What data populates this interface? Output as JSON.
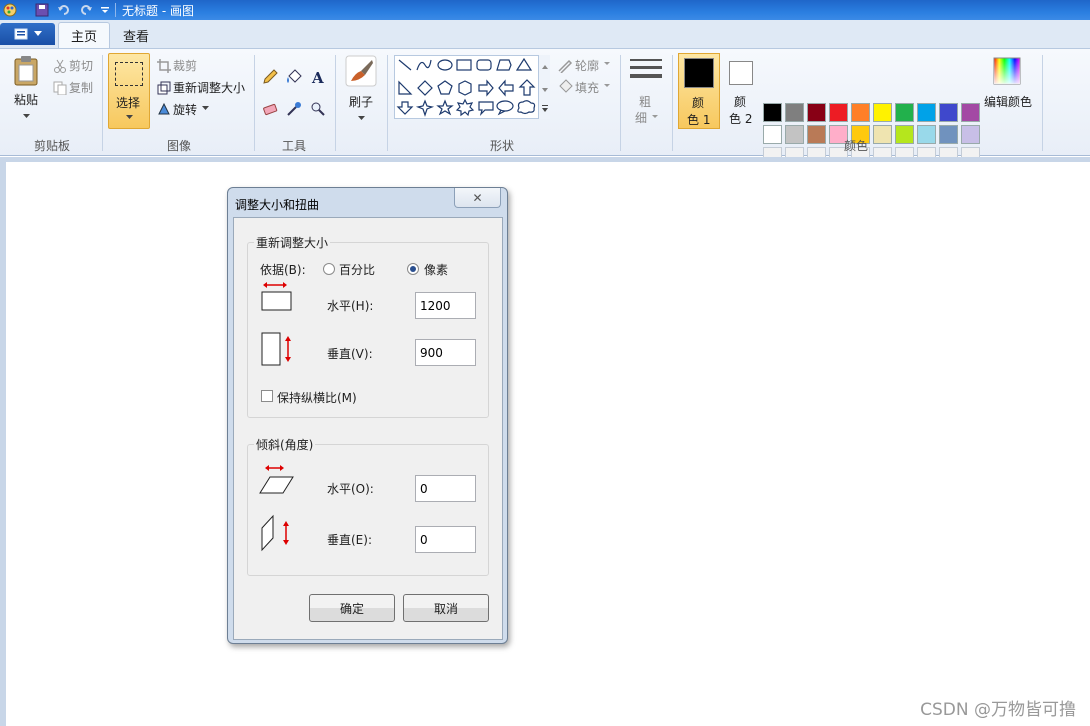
{
  "titlebar": {
    "title": "无标题 - 画图"
  },
  "tabs": [
    {
      "label": "主页"
    },
    {
      "label": "查看"
    }
  ],
  "ribbon": {
    "clipboard": {
      "paste": "粘贴",
      "cut": "剪切",
      "copy": "复制",
      "group": "剪贴板"
    },
    "image": {
      "select": "选择",
      "crop": "裁剪",
      "resize": "重新调整大小",
      "rotate": "旋转",
      "group": "图像"
    },
    "tools": {
      "group": "工具"
    },
    "brush": {
      "label": "刷子"
    },
    "shapes": {
      "outline": "轮廓",
      "fill": "填充",
      "group": "形状"
    },
    "size": {
      "label1": "粗",
      "label2": "细"
    },
    "colors": {
      "color1_a": "颜",
      "color1_b": "色 1",
      "color2_a": "颜",
      "color2_b": "色 2",
      "edit": "编辑颜色",
      "group": "颜色",
      "color1_value": "#000000",
      "color2_value": "#ffffff",
      "row1": [
        "#000000",
        "#7f7f7f",
        "#880015",
        "#ed1c24",
        "#ff7f27",
        "#fff200",
        "#22b14c",
        "#00a2e8",
        "#3f48cc",
        "#a349a4"
      ],
      "row2": [
        "#ffffff",
        "#c3c3c3",
        "#b97a57",
        "#ffaec9",
        "#ffc90e",
        "#efe4b0",
        "#b5e61d",
        "#99d9ea",
        "#7092be",
        "#c8bfe7"
      ]
    }
  },
  "dialog": {
    "title": "调整大小和扭曲",
    "close": "✕",
    "resize": {
      "legend": "重新调整大小",
      "by_label": "依据(B):",
      "percent": "百分比",
      "pixels": "像素",
      "horizontal_label": "水平(H):",
      "horizontal_value": "1200",
      "vertical_label": "垂直(V):",
      "vertical_value": "900",
      "keep_ratio": "保持纵横比(M)"
    },
    "skew": {
      "legend": "倾斜(角度)",
      "horizontal_label": "水平(O):",
      "horizontal_value": "0",
      "vertical_label": "垂直(E):",
      "vertical_value": "0"
    },
    "ok": "确定",
    "cancel": "取消"
  },
  "watermark": "CSDN @万物皆可撸"
}
